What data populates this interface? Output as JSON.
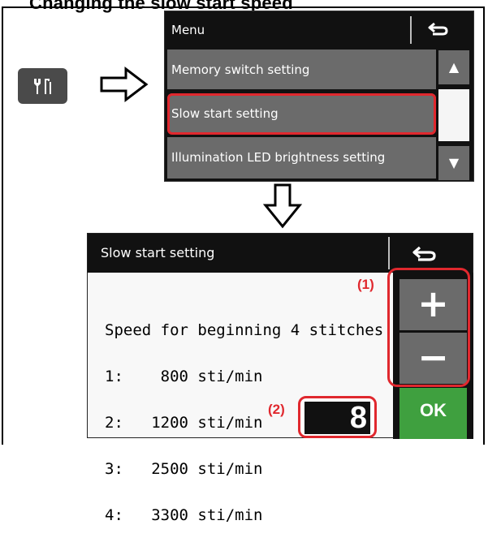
{
  "heading": "Changing the slow start speed",
  "menu": {
    "title": "Menu",
    "items": [
      {
        "label": "Memory switch setting"
      },
      {
        "label": "Slow start setting"
      },
      {
        "label": "Illumination LED brightness setting"
      }
    ],
    "scroll_up": "▲",
    "scroll_down": "▼"
  },
  "screen": {
    "title": "Slow start setting",
    "speed_lines": [
      "Speed for beginning 4 stitches",
      "1:    800 sti/min",
      "2:   1200 sti/min",
      "3:   2500 sti/min",
      "4:   3300 sti/min"
    ],
    "plus_label": "+",
    "minus_label": "−",
    "ok_label": "OK",
    "value": "8"
  },
  "callouts": {
    "one": "(1)",
    "two": "(2)"
  },
  "icons": {
    "tool": "settings-tools-icon",
    "back": "return-arrow-icon",
    "arrow_right": "hollow-arrow-right-icon",
    "arrow_down": "hollow-arrow-down-icon"
  },
  "colors": {
    "highlight": "#e0282e",
    "ok": "#3fa03f",
    "button": "#6b6b6b"
  }
}
